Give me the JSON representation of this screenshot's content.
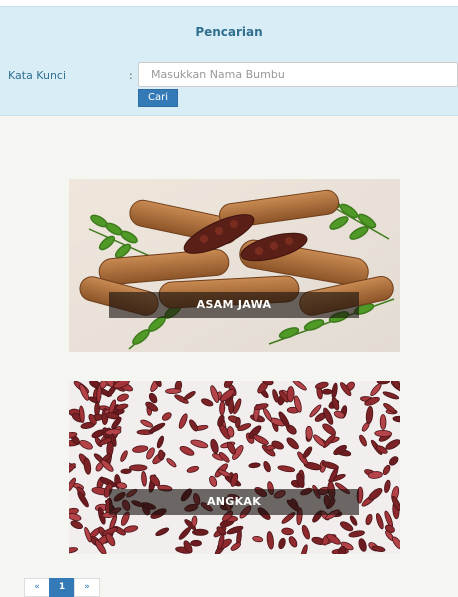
{
  "search": {
    "title": "Pencarian",
    "keyword_label": "Kata Kunci",
    "colon": ":",
    "placeholder": "Masukkan Nama Bumbu",
    "value": "",
    "button_label": "Cari"
  },
  "results": [
    {
      "name": "ASAM JAWA",
      "image": "tamarind-photo"
    },
    {
      "name": "ANGKAK",
      "image": "red-yeast-rice-photo"
    }
  ],
  "pagination": {
    "prev": "«",
    "pages": [
      "1"
    ],
    "current": "1",
    "next": "»"
  },
  "colors": {
    "panel_bg": "#d9edf7",
    "panel_text": "#31708f",
    "primary": "#337ab7",
    "content_bg": "#f5f6f1"
  }
}
